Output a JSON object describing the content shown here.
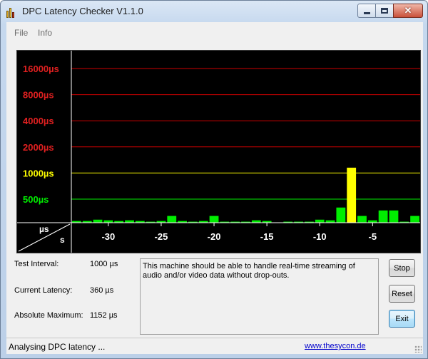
{
  "window": {
    "title": "DPC Latency Checker V1.1.0",
    "icon": "bar-chart-app-icon"
  },
  "caption_buttons": {
    "minimize_icon": "minimize-icon",
    "maximize_icon": "maximize-icon",
    "close_icon": "close-icon",
    "close_glyph": "✕"
  },
  "menu": {
    "file": "File",
    "info": "Info"
  },
  "chart": {
    "colors": {
      "background": "#000000",
      "red_line": "#cc0000",
      "red_label": "#e02020",
      "yellow": "#ffff00",
      "green": "#00ee00",
      "white": "#ffffff"
    },
    "corner_top_label": "µs",
    "corner_bottom_label": "s"
  },
  "chart_data": {
    "type": "bar",
    "y_scale": "log",
    "ylabel_unit": "µs",
    "y_ticks": [
      {
        "label": "16000µs",
        "value": 16000,
        "color": "red"
      },
      {
        "label": "8000µs",
        "value": 8000,
        "color": "red"
      },
      {
        "label": "4000µs",
        "value": 4000,
        "color": "red"
      },
      {
        "label": "2000µs",
        "value": 2000,
        "color": "red"
      },
      {
        "label": "1000µs",
        "value": 1000,
        "color": "yellow"
      },
      {
        "label": "500µs",
        "value": 500,
        "color": "green"
      }
    ],
    "x_unit": "s",
    "x_ticks": [
      {
        "label": "-30",
        "value": -30
      },
      {
        "label": "-25",
        "value": -25
      },
      {
        "label": "-20",
        "value": -20
      },
      {
        "label": "-15",
        "value": -15
      },
      {
        "label": "-10",
        "value": -10
      },
      {
        "label": "-5",
        "value": -5
      }
    ],
    "x_range": [
      -33,
      0
    ],
    "bars": [
      {
        "x": -33,
        "value": 280,
        "color": "green"
      },
      {
        "x": -32,
        "value": 280,
        "color": "green"
      },
      {
        "x": -31,
        "value": 290,
        "color": "green"
      },
      {
        "x": -30,
        "value": 285,
        "color": "green"
      },
      {
        "x": -29,
        "value": 280,
        "color": "green"
      },
      {
        "x": -28,
        "value": 285,
        "color": "green"
      },
      {
        "x": -27,
        "value": 280,
        "color": "green"
      },
      {
        "x": -26,
        "value": 275,
        "color": "green"
      },
      {
        "x": -25,
        "value": 280,
        "color": "green"
      },
      {
        "x": -24,
        "value": 320,
        "color": "green"
      },
      {
        "x": -23,
        "value": 280,
        "color": "green"
      },
      {
        "x": -22,
        "value": 275,
        "color": "green"
      },
      {
        "x": -21,
        "value": 280,
        "color": "green"
      },
      {
        "x": -20,
        "value": 320,
        "color": "green"
      },
      {
        "x": -19,
        "value": 275,
        "color": "green"
      },
      {
        "x": -18,
        "value": 275,
        "color": "green"
      },
      {
        "x": -17,
        "value": 275,
        "color": "green"
      },
      {
        "x": -16,
        "value": 285,
        "color": "green"
      },
      {
        "x": -15,
        "value": 280,
        "color": "green"
      },
      {
        "x": -14,
        "value": 270,
        "color": "green"
      },
      {
        "x": -13,
        "value": 275,
        "color": "green"
      },
      {
        "x": -12,
        "value": 275,
        "color": "green"
      },
      {
        "x": -11,
        "value": 275,
        "color": "green"
      },
      {
        "x": -10,
        "value": 290,
        "color": "green"
      },
      {
        "x": -9,
        "value": 285,
        "color": "green"
      },
      {
        "x": -8,
        "value": 400,
        "color": "green"
      },
      {
        "x": -7,
        "value": 1152,
        "color": "yellow"
      },
      {
        "x": -6,
        "value": 320,
        "color": "green"
      },
      {
        "x": -5,
        "value": 285,
        "color": "green"
      },
      {
        "x": -4,
        "value": 370,
        "color": "green"
      },
      {
        "x": -3,
        "value": 370,
        "color": "green"
      },
      {
        "x": -2,
        "value": 275,
        "color": "green"
      },
      {
        "x": -1,
        "value": 320,
        "color": "green"
      }
    ]
  },
  "stats": {
    "test_interval_label": "Test Interval:",
    "test_interval_value": "1000 µs",
    "current_latency_label": "Current Latency:",
    "current_latency_value": "360 µs",
    "absolute_maximum_label": "Absolute Maximum:",
    "absolute_maximum_value": "1152 µs"
  },
  "message": "This machine should be able to handle real-time streaming of audio and/or video data without drop-outs.",
  "buttons": {
    "stop": "Stop",
    "reset": "Reset",
    "exit": "Exit"
  },
  "status": {
    "text": "Analysing DPC latency ...",
    "link": "www.thesycon.de"
  }
}
